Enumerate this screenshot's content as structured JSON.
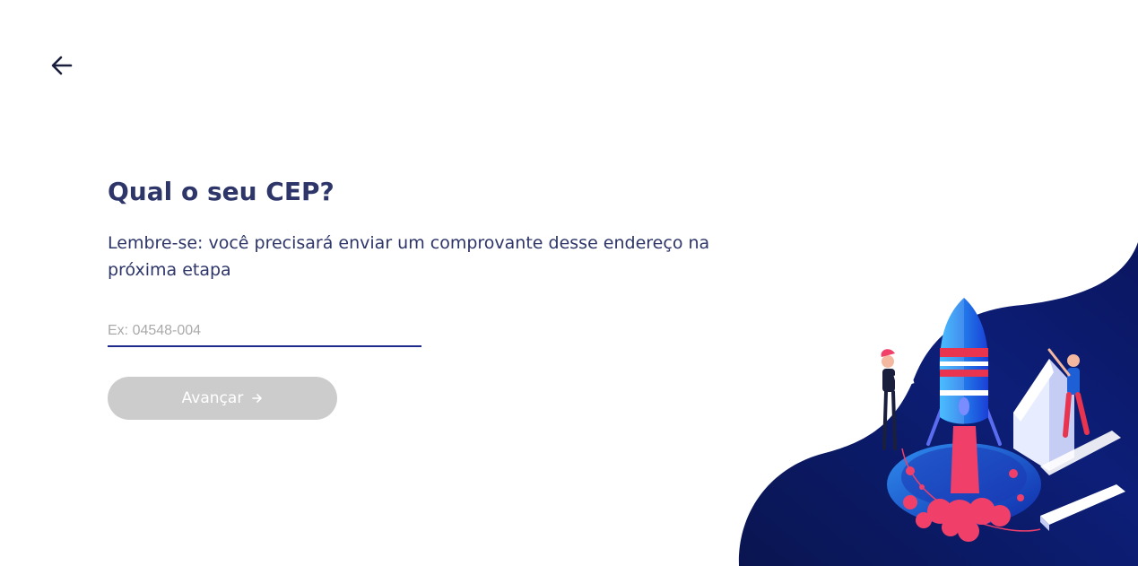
{
  "header": {
    "back_icon": "arrow-left-icon"
  },
  "main": {
    "title": "Qual o seu CEP?",
    "subtitle": "Lembre-se: você precisará enviar um comprovante desse endereço na próxima etapa",
    "cep_input": {
      "placeholder": "Ex: 04548-004",
      "value": ""
    },
    "next_button": {
      "label": "Avançar",
      "icon": "arrow-right-icon",
      "enabled": false
    }
  },
  "colors": {
    "primary_text": "#2d3569",
    "input_underline": "#1e2a8c",
    "button_disabled": "#cccccc",
    "illustration_bg": "#0b1660",
    "accent_pink": "#f0406a",
    "accent_blue": "#2c6fe0"
  },
  "illustration": {
    "name": "rocket-launch-illustration"
  }
}
